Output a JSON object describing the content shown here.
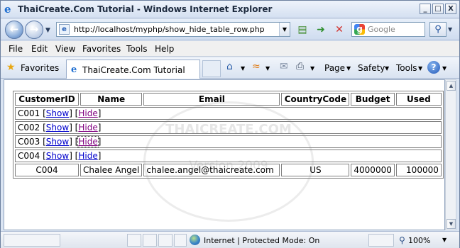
{
  "window": {
    "title": "ThaiCreate.Com Tutorial - Windows Internet Explorer",
    "minimize": "_",
    "maximize": "□",
    "close": "X"
  },
  "address": {
    "url": "http://localhost/myphp/show_hide_table_row.php",
    "search_placeholder": "Google"
  },
  "menu": [
    "File",
    "Edit",
    "View",
    "Favorites",
    "Tools",
    "Help"
  ],
  "favorites_bar": {
    "favorites_label": "Favorites",
    "tab_title": "ThaiCreate.Com Tutorial",
    "commands": [
      "Page",
      "Safety",
      "Tools"
    ]
  },
  "watermark": {
    "line1": "THAICREATE.COM",
    "line2": "Version 2009"
  },
  "table": {
    "headers": [
      "CustomerID",
      "Name",
      "Email",
      "CountryCode",
      "Budget",
      "Used"
    ],
    "toggle_rows": [
      {
        "id": "C001",
        "show": "Show",
        "hide": "Hide"
      },
      {
        "id": "C002",
        "show": "Show",
        "hide": "Hide"
      },
      {
        "id": "C003",
        "show": "Show",
        "hide": "Hide"
      },
      {
        "id": "C004",
        "show": "Show",
        "hide": "Hide"
      }
    ],
    "detail_row": {
      "id": "C004",
      "name": "Chalee Angel",
      "email": "chalee.angel@thaicreate.com",
      "country": "US",
      "budget": "4000000",
      "used": "100000"
    }
  },
  "status": {
    "zone": "Internet | Protected Mode: On",
    "zoom": "100%"
  },
  "icons": {
    "ie_logo": "ie-logo-icon",
    "back": "back-arrow-icon",
    "forward": "forward-arrow-icon",
    "refresh": "refresh-icon",
    "stop": "stop-icon",
    "favorites": "star-icon",
    "home": "home-icon",
    "feeds": "feeds-icon",
    "mail": "mail-icon",
    "print": "print-icon",
    "help": "help-icon"
  },
  "colors": {
    "link": "#0000cc",
    "visited_link": "#800080",
    "chrome_blue": "#dbe5f3"
  }
}
